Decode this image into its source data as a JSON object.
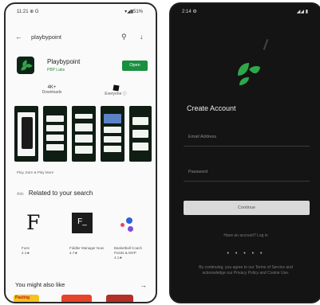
{
  "left_phone": {
    "status_time": "11:21 ⊕ G",
    "status_icons": "▾◢▮51%",
    "search_query": "playbypoint",
    "app_title": "Playbypoint",
    "app_developer": "PBP Labs",
    "open_label": "Open",
    "meta": [
      {
        "value": "4K+",
        "label": "Downloads"
      },
      {
        "value": "",
        "label": "Everyone ⓘ"
      }
    ],
    "screenshots_caption": "Play, Earn & Play More",
    "related_title": "Related to your search",
    "related_apps": [
      {
        "name": "Fuze",
        "rating": "4.1★"
      },
      {
        "name": "Fiddler Manager Now",
        "rating": "4.7★"
      },
      {
        "name": "Basketball Coach Points & MVP",
        "rating": "4.1★"
      }
    ],
    "you_might_title": "You might also like",
    "tile_label": "Pasting"
  },
  "right_phone": {
    "status_time": "2:14 ⚙",
    "status_icons": "◢◢ ▮",
    "title": "Create Account",
    "email_placeholder": "Email Address",
    "password_placeholder": "Password",
    "continue_label": "Continue",
    "signin_text": "Have an account? Log in",
    "terms_text": "By continuing, you agree to our Terms of Service and acknowledge our Privacy Policy and Cookie Use."
  },
  "colors": {
    "brand_green": "#31a34a",
    "open_button": "#1a8f40",
    "dark_bg": "#141414"
  }
}
